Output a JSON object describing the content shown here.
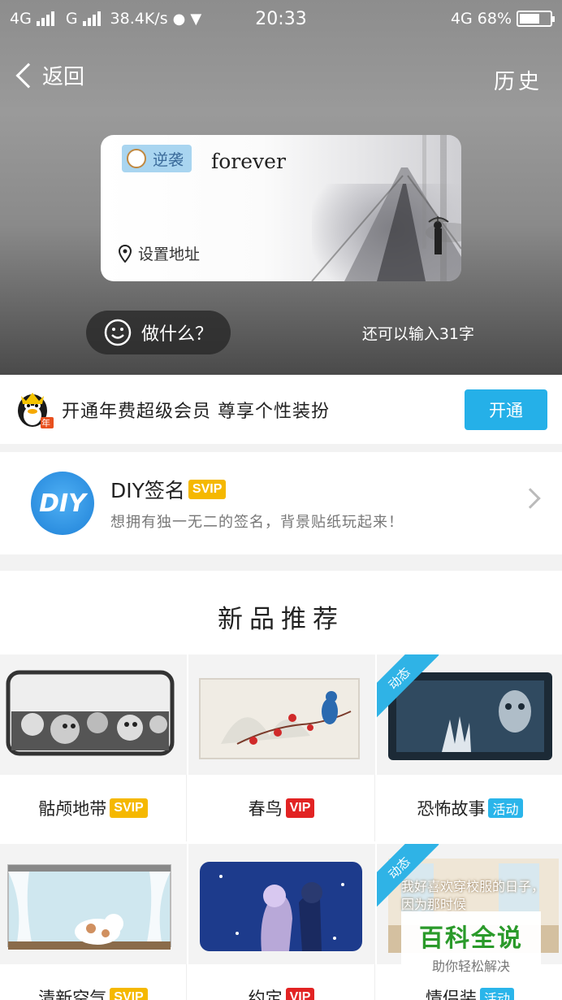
{
  "status_bar": {
    "network_left": "4G",
    "network_mid": "G",
    "speed": "38.4K/s",
    "time": "20:33",
    "network_right": "4G",
    "battery": "68%",
    "battery_level": 0.68
  },
  "nav": {
    "back_label": "返回",
    "history_label": "历史"
  },
  "card": {
    "tag": "逆袭",
    "name": "forever",
    "location": "设置地址"
  },
  "mood_button": "做什么？",
  "char_count": "还可以输入31字",
  "vip_banner": {
    "text": "开通年费超级会员 尊享个性装扮",
    "button": "开通",
    "penguin_badge": "年"
  },
  "diy": {
    "logo": "DIY",
    "title": "DIY签名",
    "badge": "SVIP",
    "description": "想拥有独一无二的签名，背景贴纸玩起来！"
  },
  "section_title": "新品推荐",
  "tiles": [
    {
      "label": "骷颅地带",
      "badge": "SVIP",
      "ribbon": ""
    },
    {
      "label": "春鸟",
      "badge": "VIP",
      "ribbon": ""
    },
    {
      "label": "恐怖故事",
      "badge": "活动",
      "ribbon": "动态"
    },
    {
      "label": "清新空气",
      "badge": "SVIP",
      "ribbon": ""
    },
    {
      "label": "约定",
      "badge": "VIP",
      "ribbon": ""
    },
    {
      "label": "情侣装",
      "badge": "活动",
      "ribbon": "动态",
      "image_text": "我好喜欢穿校服的日子，因为那时候"
    }
  ],
  "watermark": {
    "title": "百科全说",
    "subtitle": "助你轻松解决"
  },
  "colors": {
    "accent": "#25b0e8",
    "svip": "#f5b800",
    "vip": "#e22323"
  }
}
